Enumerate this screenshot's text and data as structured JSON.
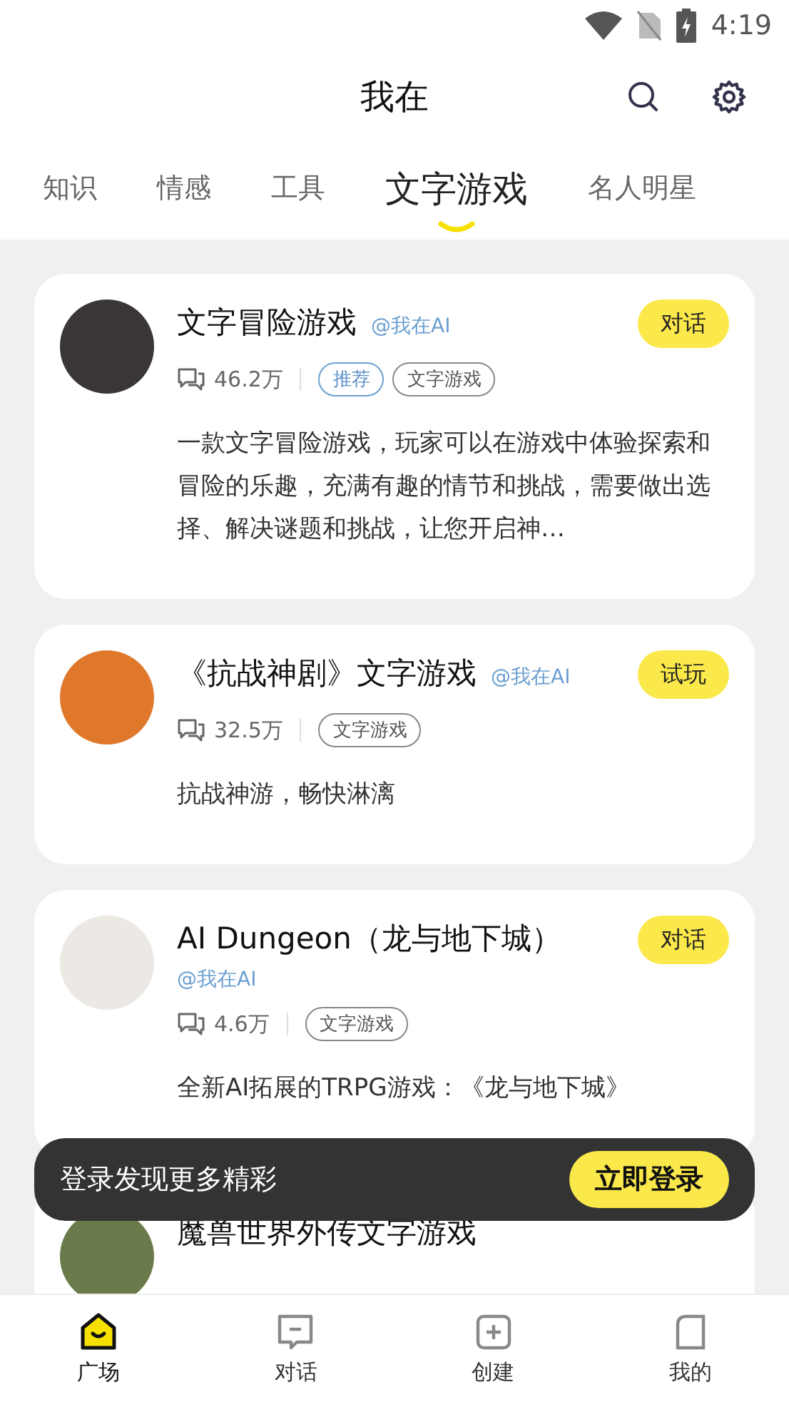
{
  "status_bar": {
    "time": "4:19"
  },
  "header": {
    "title": "我在"
  },
  "tabs": [
    {
      "label": "知识",
      "selected": false
    },
    {
      "label": "情感",
      "selected": false
    },
    {
      "label": "工具",
      "selected": false
    },
    {
      "label": "文字游戏",
      "selected": true
    },
    {
      "label": "名人明星",
      "selected": false
    }
  ],
  "cards": [
    {
      "title": "文字冒险游戏",
      "handle": "@我在AI",
      "action": "对话",
      "count": "46.2万",
      "tags": [
        {
          "label": "推荐",
          "kind": "recommend"
        },
        {
          "label": "文字游戏",
          "kind": "normal"
        }
      ],
      "description": "一款文字冒险游戏，玩家可以在游戏中体验探索和冒险的乐趣，充满有趣的情节和挑战，需要做出选择、解决谜题和挑战，让您开启神…"
    },
    {
      "title": "《抗战神剧》文字游戏",
      "handle": "@我在AI",
      "action": "试玩",
      "count": "32.5万",
      "tags": [
        {
          "label": "文字游戏",
          "kind": "normal"
        }
      ],
      "description": "抗战神游，畅快淋漓"
    },
    {
      "title": "AI Dungeon（龙与地下城）",
      "handle": "@我在AI",
      "action": "对话",
      "count": "4.6万",
      "tags": [
        {
          "label": "文字游戏",
          "kind": "normal"
        }
      ],
      "description": "全新AI拓展的TRPG游戏：《龙与地下城》"
    },
    {
      "title": "魔兽世界外传文字游戏"
    }
  ],
  "toast": {
    "message": "登录发现更多精彩",
    "button": "立即登录"
  },
  "bottom_nav": [
    {
      "label": "广场",
      "selected": true
    },
    {
      "label": "对话",
      "selected": false
    },
    {
      "label": "创建",
      "selected": false
    },
    {
      "label": "我的",
      "selected": false
    }
  ]
}
